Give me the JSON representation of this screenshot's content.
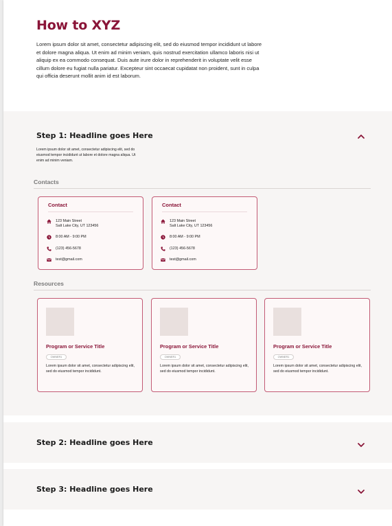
{
  "intro": {
    "title": "How to XYZ",
    "body": "Lorem ipsum dolor sit amet, consectetur adipiscing elit, sed do eiusmod tempor incididunt ut labore et dolore magna aliqua. Ut enim ad minim veniam, quis nostrud exercitation ullamco laboris nisi ut aliquip ex ea commodo consequat. Duis aute irure dolor in reprehenderit in voluptate velit esse cillum dolore eu fugiat nulla pariatur. Excepteur sint occaecat cupidatat non proident, sunt in culpa qui officia deserunt mollit anim id est laborum."
  },
  "steps": [
    {
      "title": "Step 1: Headline goes Here",
      "expanded": true,
      "chevron_icon": "chevron-up-icon",
      "description": "Lorem ipsum dolor sit amet, consectetur adipiscing elit, sed do eiusmod tempor incididunt ut labore et dolore magna aliqua. Ut enim ad minim veniam."
    },
    {
      "title": "Step 2: Headline goes Here",
      "expanded": false,
      "chevron_icon": "chevron-down-icon"
    },
    {
      "title": "Step 3: Headline goes Here",
      "expanded": false,
      "chevron_icon": "chevron-down-icon"
    }
  ],
  "contacts": {
    "label": "Contacts",
    "cards": [
      {
        "title": "Contact",
        "address_line1": "123 Main Street",
        "address_line2": "Salt Lake City, UT 123456",
        "hours": "8:00 AM - 9:00 PM",
        "phone": "(123) 456-5678",
        "email": "test@gmail.com"
      },
      {
        "title": "Contact",
        "address_line1": "123 Main Street",
        "address_line2": "Salt Lake City, UT 123456",
        "hours": "8:00 AM - 9:00 PM",
        "phone": "(123) 456-5678",
        "email": "test@gmail.com"
      }
    ]
  },
  "resources": {
    "label": "Resources",
    "cards": [
      {
        "title": "Program or Service Title",
        "tag": "OWNER1",
        "description": "Lorem ipsum dolor sit amet, consectetur adipiscing elit, sed do eiusmod tempor incididunt."
      },
      {
        "title": "Program or Service Title",
        "tag": "OWNER1",
        "description": "Lorem ipsum dolor sit amet, consectetur adipiscing elit, sed do eiusmod tempor incididunt."
      },
      {
        "title": "Program or Service Title",
        "tag": "OWNER1",
        "description": "Lorem ipsum dolor sit amet, consectetur adipiscing elit, sed do eiusmod tempor incididunt."
      }
    ]
  },
  "icons": {
    "address": "home-icon",
    "hours": "clock-icon",
    "phone": "phone-icon",
    "email": "mail-icon"
  },
  "colors": {
    "brand": "#8a1538",
    "card_border": "#c25a74",
    "card_bg": "#fdf8f8",
    "section_bg": "#f7f5f4",
    "thumbnail": "#e9e0de"
  }
}
